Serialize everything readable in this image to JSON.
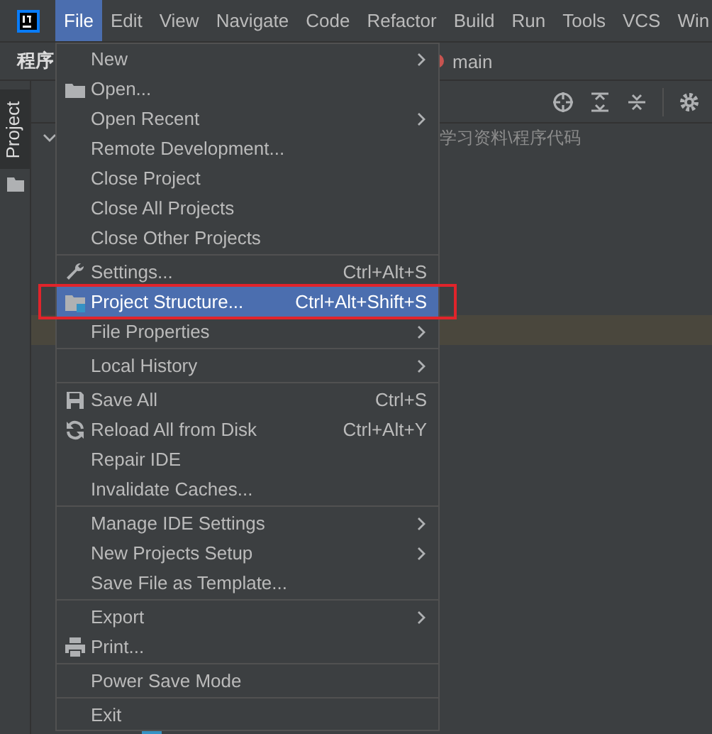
{
  "menu_bar": [
    {
      "label": "File",
      "selected": true
    },
    {
      "label": "Edit",
      "selected": false
    },
    {
      "label": "View",
      "selected": false
    },
    {
      "label": "Navigate",
      "selected": false
    },
    {
      "label": "Code",
      "selected": false
    },
    {
      "label": "Refactor",
      "selected": false
    },
    {
      "label": "Build",
      "selected": false
    },
    {
      "label": "Run",
      "selected": false
    },
    {
      "label": "Tools",
      "selected": false
    },
    {
      "label": "VCS",
      "selected": false
    },
    {
      "label": "Win",
      "selected": false
    }
  ],
  "toolbar": {
    "project_name": "程序",
    "branch": "main"
  },
  "tool_window_stripe": {
    "label": "Project"
  },
  "project_panel": {
    "path": "学习资料\\程序代码"
  },
  "file_menu": {
    "groups": [
      [
        {
          "label": "New",
          "submenu": true,
          "selected": false
        },
        {
          "label": "Open...",
          "kind": "folder",
          "selected": false
        },
        {
          "label": "Open Recent",
          "submenu": true,
          "selected": false
        },
        {
          "label": "Remote Development...",
          "selected": false
        },
        {
          "label": "Close Project",
          "selected": false
        },
        {
          "label": "Close All Projects",
          "selected": false
        },
        {
          "label": "Close Other Projects",
          "selected": false
        }
      ],
      [
        {
          "label": "Settings...",
          "kind": "wrench",
          "shortcut": "Ctrl+Alt+S",
          "selected": false
        },
        {
          "label": "Project Structure...",
          "kind": "project-folder",
          "shortcut": "Ctrl+Alt+Shift+S",
          "selected": true
        },
        {
          "label": "File Properties",
          "submenu": true,
          "selected": false
        }
      ],
      [
        {
          "label": "Local History",
          "submenu": true,
          "selected": false
        }
      ],
      [
        {
          "label": "Save All",
          "kind": "floppy",
          "shortcut": "Ctrl+S",
          "selected": false
        },
        {
          "label": "Reload All from Disk",
          "kind": "reload",
          "shortcut": "Ctrl+Alt+Y",
          "selected": false
        },
        {
          "label": "Repair IDE",
          "selected": false
        },
        {
          "label": "Invalidate Caches...",
          "selected": false
        }
      ],
      [
        {
          "label": "Manage IDE Settings",
          "submenu": true,
          "selected": false
        },
        {
          "label": "New Projects Setup",
          "submenu": true,
          "selected": false
        },
        {
          "label": "Save File as Template...",
          "selected": false
        }
      ],
      [
        {
          "label": "Export",
          "submenu": true,
          "selected": false
        },
        {
          "label": "Print...",
          "kind": "printer",
          "selected": false
        }
      ],
      [
        {
          "label": "Power Save Mode",
          "selected": false
        }
      ],
      [
        {
          "label": "Exit",
          "selected": false
        }
      ]
    ]
  },
  "highlight": {
    "kind": "rectangle"
  }
}
